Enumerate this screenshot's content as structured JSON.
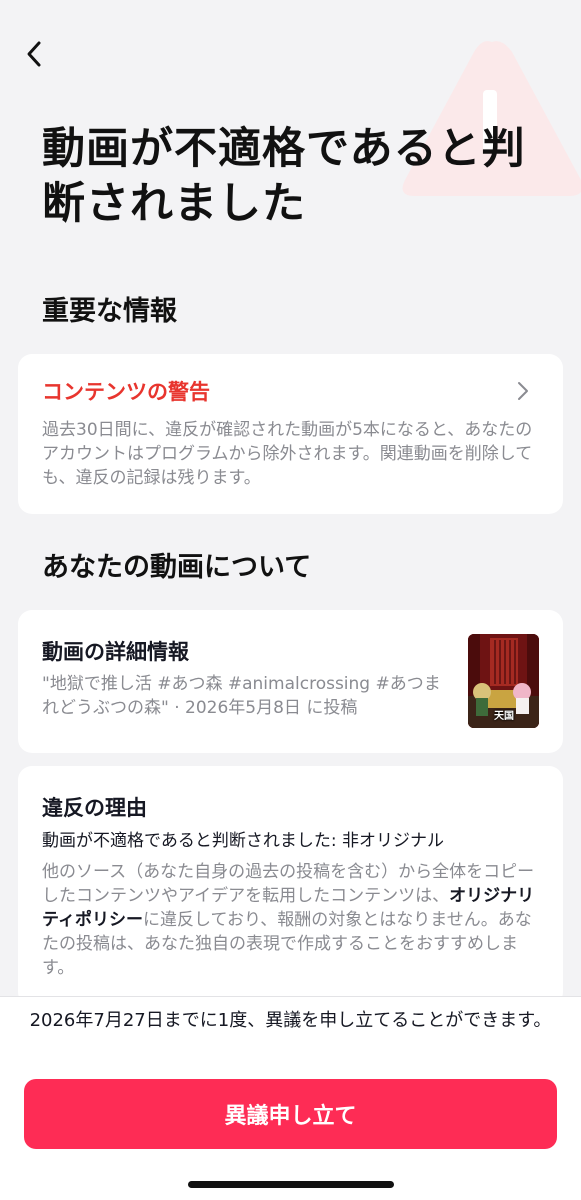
{
  "header": {
    "title": "動画が不適格であると判断されました"
  },
  "important": {
    "heading": "重要な情報",
    "card": {
      "title": "コンテンツの警告",
      "description": "過去30日間に、違反が確認された動画が5本になると、あなたのアカウントはプログラムから除外されます。関連動画を削除しても、違反の記録は残ります。"
    }
  },
  "about": {
    "heading": "あなたの動画について",
    "details": {
      "title": "動画の詳細情報",
      "description": "\"地獄で推し活 #あつ森 #animalcrossing #あつまれどうぶつの森\" · 2026年5月8日 に投稿",
      "thumbnail_label": "天国"
    },
    "reason": {
      "title": "違反の理由",
      "verdict": "動画が不適格であると判断されました: 非オリジナル",
      "desc_before": "他のソース（あなた自身の過去の投稿を含む）から全体をコピーしたコンテンツやアイデアを転用したコンテンツは、",
      "desc_link": "オリジナリティポリシー",
      "desc_after": "に違反しており、報酬の対象とはなりません。あなたの投稿は、あなた独自の表現で作成することをおすすめします。"
    }
  },
  "footer": {
    "deadline": "2026年7月27日までに1度、異議を申し立てることができます。",
    "appeal_label": "異議申し立て"
  },
  "icons": {
    "back": "chevron-left-icon",
    "warning": "warning-triangle-icon",
    "chevron": "chevron-right-icon"
  },
  "colors": {
    "accent_red": "#e8352e",
    "button": "#fe2c55",
    "background": "#f3f3f5"
  }
}
